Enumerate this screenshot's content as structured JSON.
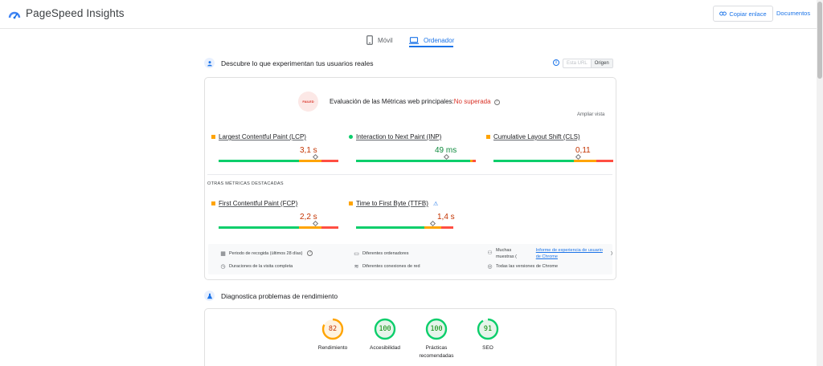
{
  "header": {
    "title": "PageSpeed Insights",
    "copy_link": "Copiar enlace",
    "docs": "Documentos"
  },
  "tabs": [
    {
      "label": "Móvil",
      "active": false,
      "icon": "smartphone-icon"
    },
    {
      "label": "Ordenador",
      "active": true,
      "icon": "laptop-icon"
    }
  ],
  "field": {
    "title": "Descubre lo que experimentan tus usuarios reales",
    "toggle_off": "Esta URL",
    "toggle_on": "Origen",
    "cwv_label": "Evaluación de las Métricas web principales:",
    "cwv_status": "No superada",
    "badge_text": "FAILED",
    "expand": "Ampliar vista",
    "metrics": [
      {
        "name": "Largest Contentful Paint (LCP)",
        "value": "3,1 s",
        "rating": "average",
        "distribution": [
          0.67,
          0.19,
          0.14
        ],
        "marker": 0.81
      },
      {
        "name": "Interaction to Next Paint (INP)",
        "value": "49 ms",
        "rating": "good",
        "distribution": [
          0.95,
          0.02,
          0.03
        ],
        "marker": 0.76
      },
      {
        "name": "Cumulative Layout Shift (CLS)",
        "value": "0,11",
        "rating": "average",
        "distribution": [
          0.67,
          0.19,
          0.14
        ],
        "marker": 0.71
      }
    ],
    "other_title": "OTRAS MÉTRICAS DESTACADAS",
    "other_metrics": [
      {
        "name": "First Contentful Paint (FCP)",
        "value": "2,2 s",
        "rating": "average",
        "distribution": [
          0.67,
          0.19,
          0.14
        ],
        "marker": 0.81
      },
      {
        "name": "Time to First Byte (TTFB)",
        "value": "1,4 s",
        "rating": "average",
        "distribution": [
          0.7,
          0.18,
          0.12
        ],
        "marker": 0.79,
        "experimental": true
      }
    ],
    "info": {
      "period": "Periodo de recogida (últimos 28 días)",
      "devices": "Diferentes ordenadores",
      "samples_prefix": "Muchas muestras (",
      "samples_link": "Informe de experiencia de usuario de Chrome",
      "samples_suffix": ")",
      "visits": "Duraciones de la visita completa",
      "network": "Diferentes conexiones de red",
      "chrome": "Todas las versiones de Chrome"
    }
  },
  "lab": {
    "title": "Diagnostica problemas de rendimiento",
    "scores": [
      {
        "label": "Rendimiento",
        "score": 82,
        "color": "#ffa400"
      },
      {
        "label": "Accesibilidad",
        "score": 100,
        "color": "#0cce6b"
      },
      {
        "label": "Prácticas recomendadas",
        "score": 100,
        "color": "#0cce6b"
      },
      {
        "label": "SEO",
        "score": 91,
        "color": "#0cce6b"
      }
    ]
  },
  "colors": {
    "accent": "#1a73e8",
    "good": "#0cce6b",
    "average": "#ffa400",
    "poor": "#ff4e42"
  }
}
